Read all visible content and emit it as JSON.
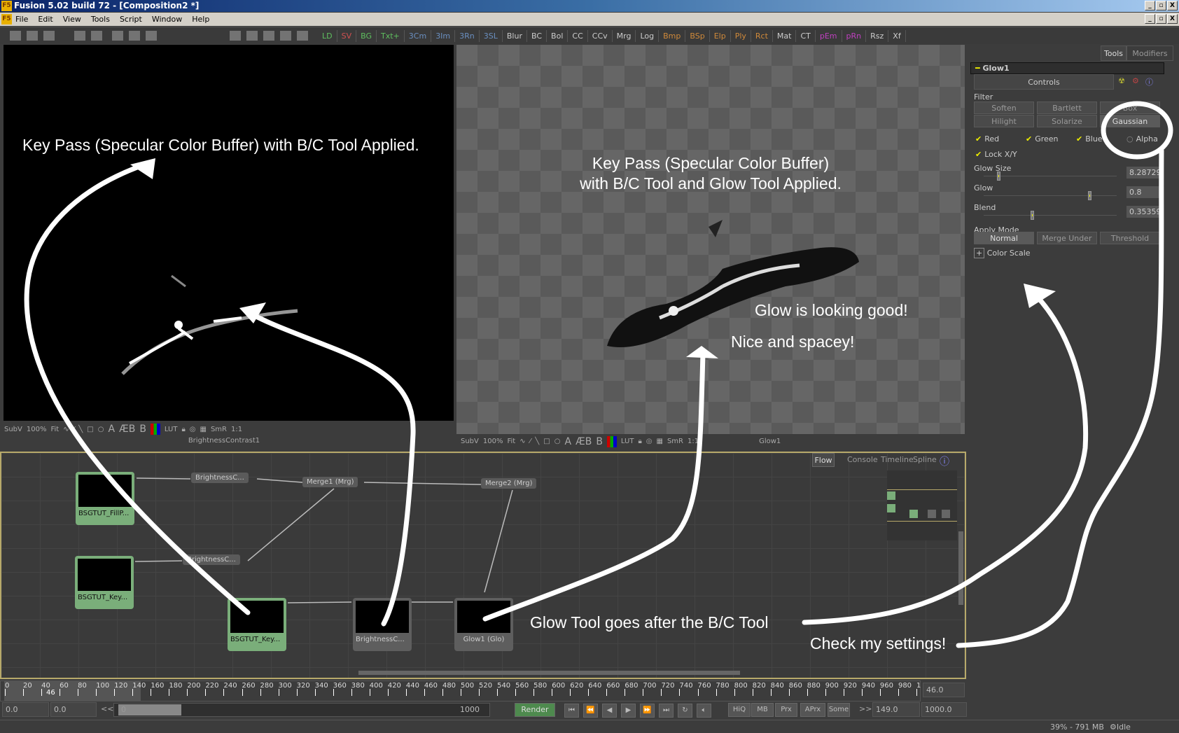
{
  "window": {
    "title": "Fusion 5.02 build 72 - [Composition2 *]",
    "app_icon": "F5",
    "controls": [
      "_",
      "▫",
      "X"
    ]
  },
  "menu": [
    "File",
    "Edit",
    "View",
    "Tools",
    "Script",
    "Window",
    "Help"
  ],
  "toolbar": {
    "tools": [
      {
        "label": "LD",
        "color": "#5fbf5f"
      },
      {
        "label": "SV",
        "color": "#d05050"
      },
      {
        "label": "BG",
        "color": "#5fbf5f"
      },
      {
        "label": "Txt+",
        "color": "#5fbf5f"
      },
      {
        "label": "3Cm",
        "color": "#6a8fc0"
      },
      {
        "label": "3Im",
        "color": "#6a8fc0"
      },
      {
        "label": "3Rn",
        "color": "#6a8fc0"
      },
      {
        "label": "3SL",
        "color": "#6a8fc0"
      },
      {
        "label": "Blur",
        "color": "#cccccc"
      },
      {
        "label": "BC",
        "color": "#cccccc"
      },
      {
        "label": "Bol",
        "color": "#cccccc"
      },
      {
        "label": "CC",
        "color": "#cccccc"
      },
      {
        "label": "CCv",
        "color": "#cccccc"
      },
      {
        "label": "Mrg",
        "color": "#cccccc"
      },
      {
        "label": "Log",
        "color": "#cccccc"
      },
      {
        "label": "Bmp",
        "color": "#d08a3a"
      },
      {
        "label": "BSp",
        "color": "#d08a3a"
      },
      {
        "label": "Elp",
        "color": "#d08a3a"
      },
      {
        "label": "Ply",
        "color": "#d08a3a"
      },
      {
        "label": "Rct",
        "color": "#d08a3a"
      },
      {
        "label": "Mat",
        "color": "#cccccc"
      },
      {
        "label": "CT",
        "color": "#cccccc"
      },
      {
        "label": "pEm",
        "color": "#c040c0"
      },
      {
        "label": "pRn",
        "color": "#c040c0"
      },
      {
        "label": "Rsz",
        "color": "#cccccc"
      },
      {
        "label": "Xf",
        "color": "#cccccc"
      }
    ]
  },
  "viewers": {
    "left": {
      "subv": "SubV",
      "zoom": "100%",
      "fit": "Fit",
      "lut": "LUT",
      "smr": "SmR",
      "ratio": "1:1",
      "name": "BrightnessContrast1",
      "abc": [
        "A",
        "ÆB",
        "B"
      ]
    },
    "right": {
      "subv": "SubV",
      "zoom": "100%",
      "fit": "Fit",
      "lut": "LUT",
      "smr": "SmR",
      "ratio": "1:1",
      "name": "Glow1",
      "abc": [
        "A",
        "ÆB",
        "B"
      ]
    }
  },
  "panel": {
    "tabs": [
      "Tools",
      "Modifiers"
    ],
    "tool_name": "Glow1",
    "controls_tab": "Controls",
    "filter_label": "Filter",
    "filter_buttons": [
      "Soften",
      "Bartlett",
      "Box",
      "Hilight",
      "Solarize",
      "Gaussian"
    ],
    "filter_selected": "Gaussian",
    "channels": [
      {
        "label": "Red",
        "checked": true
      },
      {
        "label": "Green",
        "checked": true
      },
      {
        "label": "Blue",
        "checked": true
      },
      {
        "label": "Alpha",
        "checked": false
      }
    ],
    "lock_xy": {
      "label": "Lock X/Y",
      "checked": true
    },
    "sliders": [
      {
        "label": "Glow Size",
        "value": "8.28729",
        "pos": 0.1
      },
      {
        "label": "Glow",
        "value": "0.8",
        "pos": 0.8
      },
      {
        "label": "Blend",
        "value": "0.35359",
        "pos": 0.36
      }
    ],
    "apply_mode_label": "Apply Mode",
    "apply_modes": [
      "Normal",
      "Merge Under",
      "Threshold"
    ],
    "apply_selected": "Normal",
    "color_scale": "Color Scale"
  },
  "flow": {
    "tabs": [
      "Flow",
      "Console",
      "Timeline",
      "Spline"
    ],
    "active_tab": "Flow",
    "nodes": {
      "fill": "BSGTUT_FillP...",
      "key1": "BSGTUT_Key...",
      "key2": "BSGTUT_Key...",
      "bc1": "BrightnessC...",
      "bc2": "BrightnessC...",
      "merge1": "Merge1 (Mrg)",
      "merge2": "Merge2 (Mrg)",
      "bc3": "BrightnessC...",
      "glow": "Glow1 (Glo)"
    }
  },
  "timeline": {
    "labels": [
      "0",
      "20",
      "40",
      "60",
      "80",
      "100",
      "120",
      "140",
      "160",
      "180",
      "200",
      "220",
      "240",
      "260",
      "280",
      "300",
      "320",
      "340",
      "360",
      "380",
      "400",
      "420",
      "440",
      "460",
      "480",
      "500",
      "520",
      "540",
      "560",
      "580",
      "600",
      "620",
      "640",
      "660",
      "680",
      "700",
      "720",
      "740",
      "760",
      "780",
      "800",
      "820",
      "840",
      "860",
      "880",
      "900",
      "920",
      "940",
      "960",
      "980",
      "1"
    ],
    "current": "46",
    "current_field": "46.0",
    "global_start": "0.0",
    "render_start": "0.0",
    "range_start": "0",
    "range_end": "1000",
    "render": "Render",
    "toggles": [
      "HiQ",
      "MB",
      "Prx",
      "APrx",
      "Some"
    ],
    "more": ">>",
    "less": "<<",
    "render_end": "149.0",
    "global_end": "1000.0"
  },
  "status": {
    "memory": "39% - 791 MB",
    "state": "Idle"
  },
  "annotations": {
    "left_viewer": "Key Pass (Specular Color Buffer) with B/C Tool Applied.",
    "right_viewer_1": "Key Pass (Specular Color Buffer)",
    "right_viewer_2": "with B/C Tool and Glow Tool Applied.",
    "glow_good": "Glow is looking good!",
    "spacey": "Nice and spacey!",
    "glow_after": "Glow Tool goes after the B/C Tool",
    "check": "Check my settings!"
  }
}
